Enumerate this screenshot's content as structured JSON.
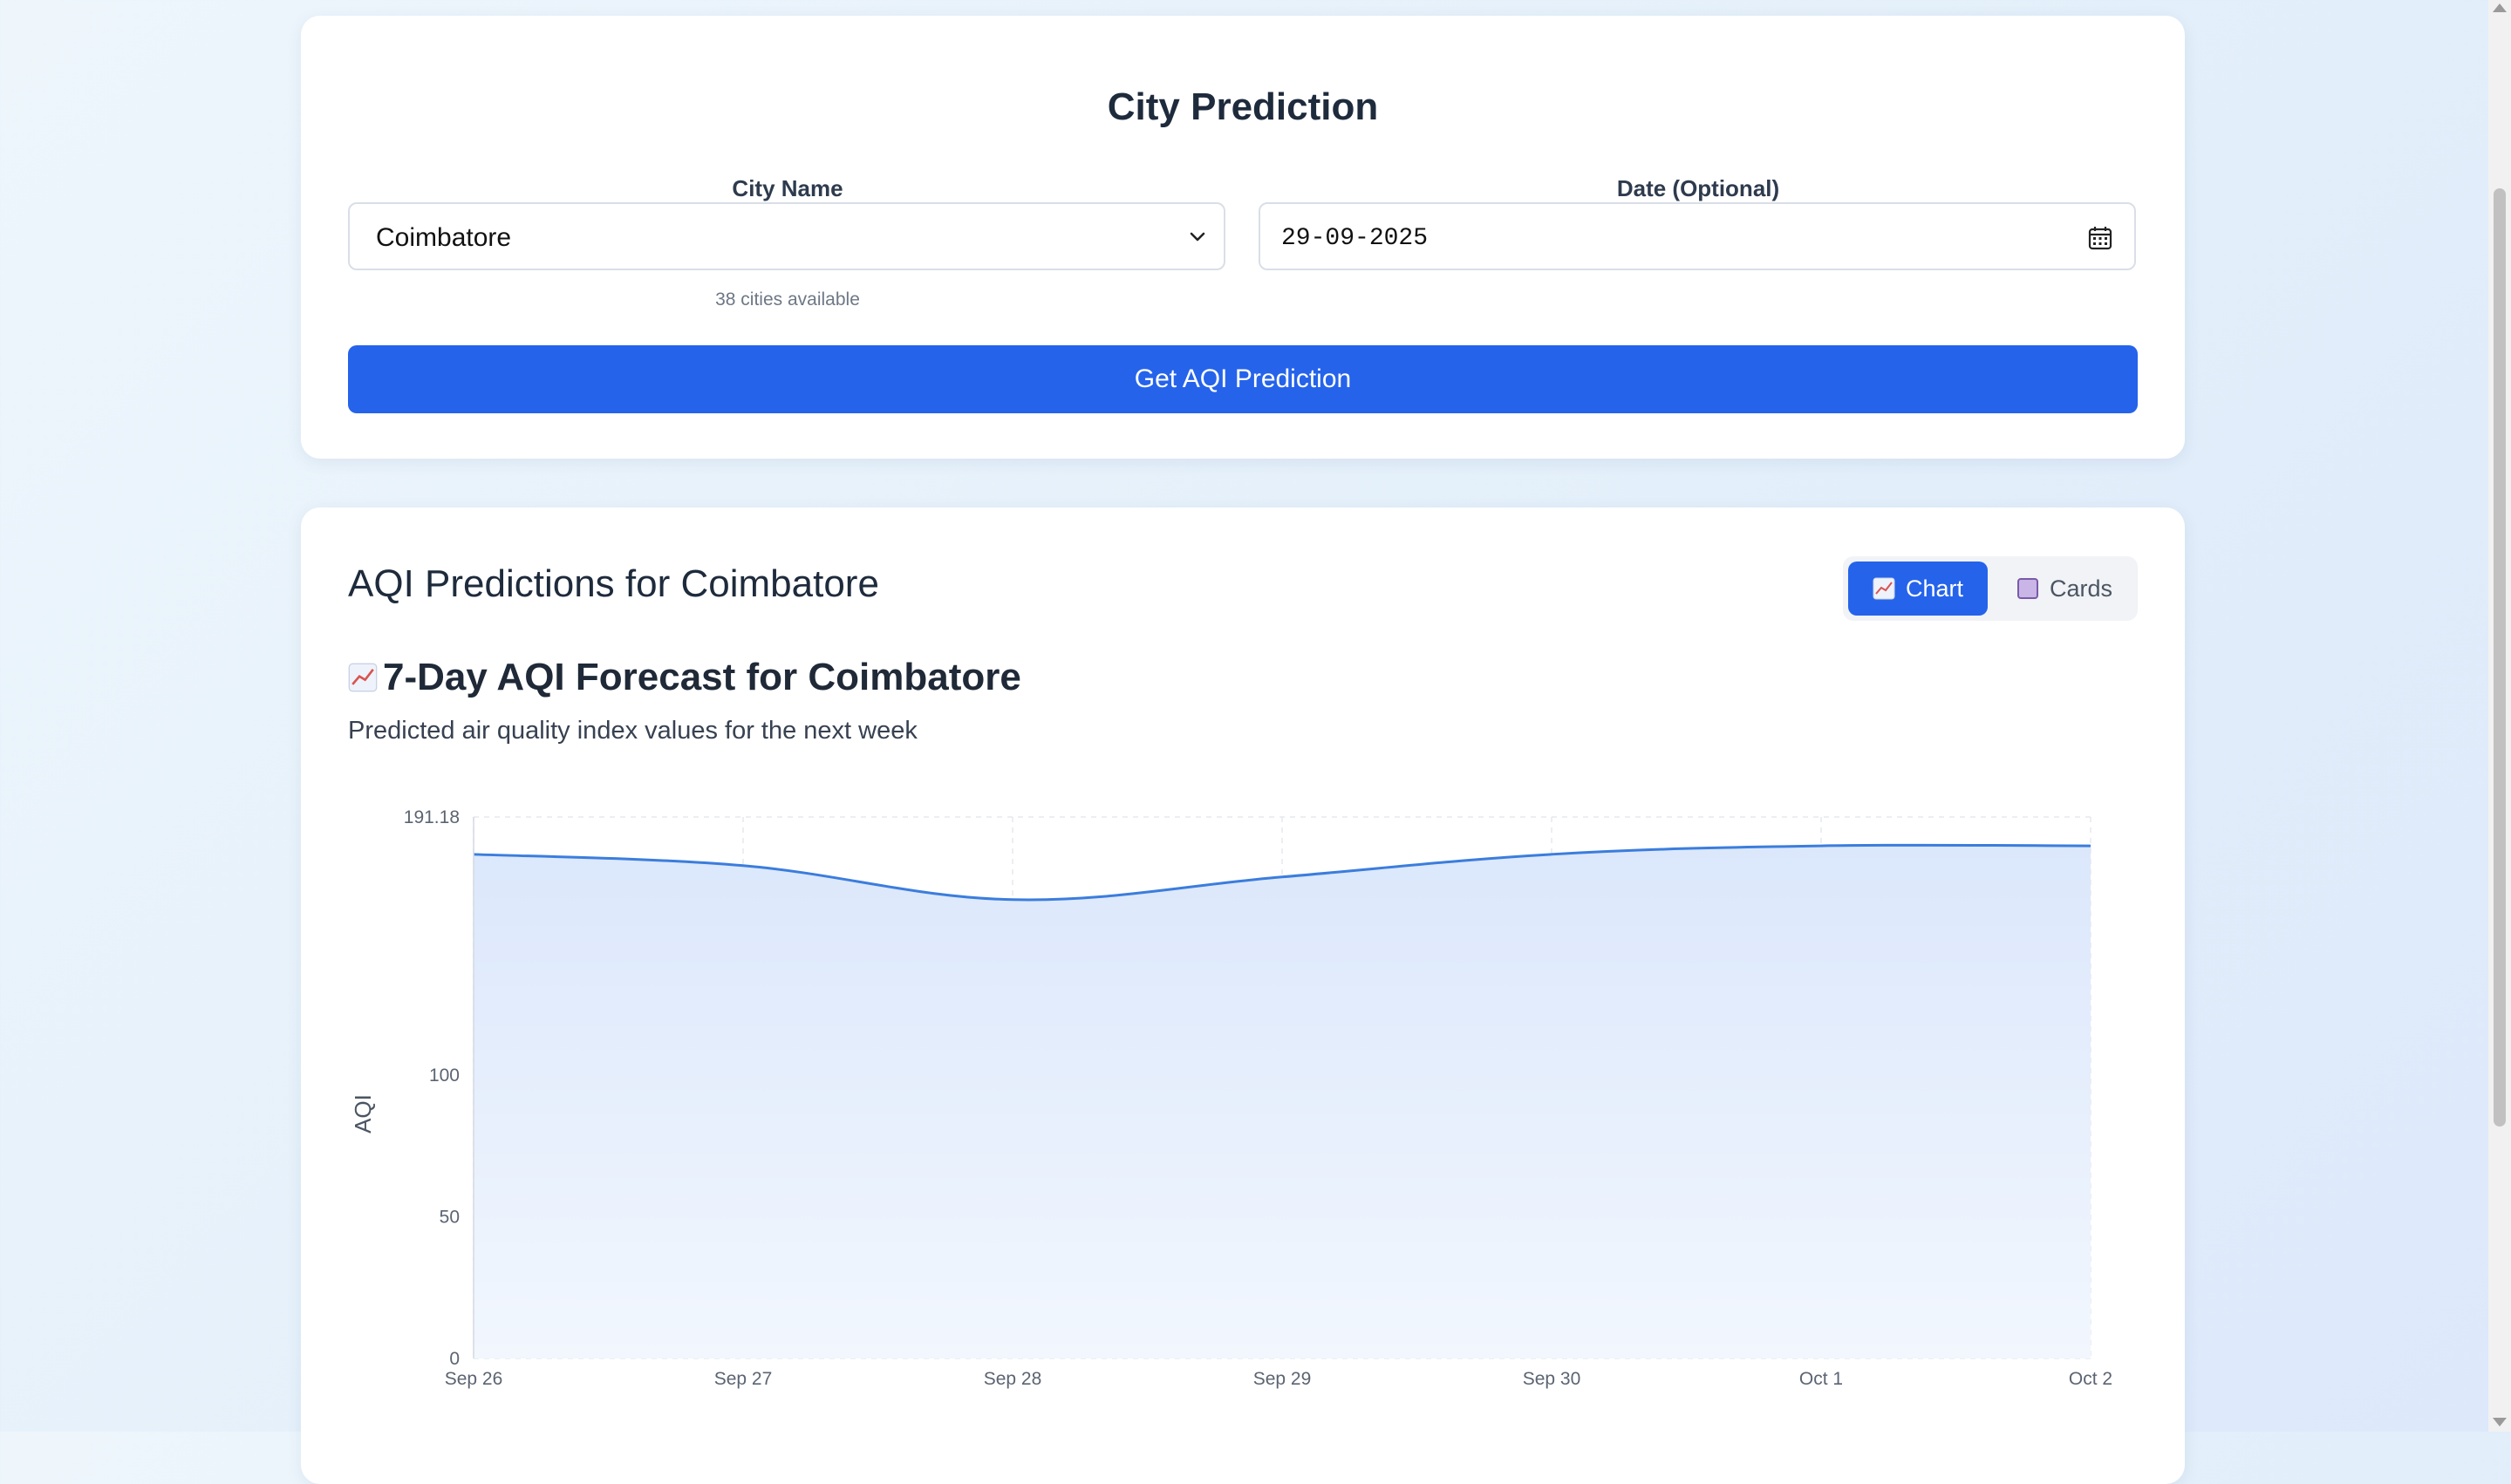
{
  "city_form": {
    "title": "City Prediction",
    "city_label": "City Name",
    "city_value": "Coimbatore",
    "date_label": "Date (Optional)",
    "date_value": "29-09-2025",
    "cities_hint": "38 cities available",
    "submit_label": "Get AQI Prediction"
  },
  "results": {
    "title": "AQI Predictions for Coimbatore",
    "view_toggle": {
      "chart_label": "Chart",
      "cards_label": "Cards",
      "active": "chart"
    },
    "chart_heading": "7-Day AQI Forecast for Coimbatore",
    "chart_subtitle": "Predicted air quality index values for the next week"
  },
  "colors": {
    "accent": "#2563eb",
    "line": "#3b7ddd",
    "area_top": "#dbe7fb",
    "area_bottom": "#f2f7fe"
  },
  "icons": {
    "city_select": "chevron-down-icon",
    "date": "calendar-icon",
    "chart_toggle": "chart-emoji-icon",
    "cards_toggle": "square-emoji-icon",
    "heading": "chart-emoji-icon"
  },
  "chart_data": {
    "type": "area",
    "categories": [
      "Sep 26",
      "Sep 27",
      "Sep 28",
      "Sep 29",
      "Sep 30",
      "Oct 1",
      "Oct 2"
    ],
    "series": [
      {
        "values": [
          178,
          174,
          162,
          170,
          178,
          181,
          181
        ]
      }
    ],
    "ylabel": "AQI",
    "xlabel": "",
    "ylim": [
      0,
      191.18
    ],
    "yticks": [
      0,
      50,
      100,
      191.18
    ],
    "ytick_labels": [
      "0",
      "50",
      "100",
      "191.18"
    ],
    "grid": true,
    "legend": "none"
  }
}
